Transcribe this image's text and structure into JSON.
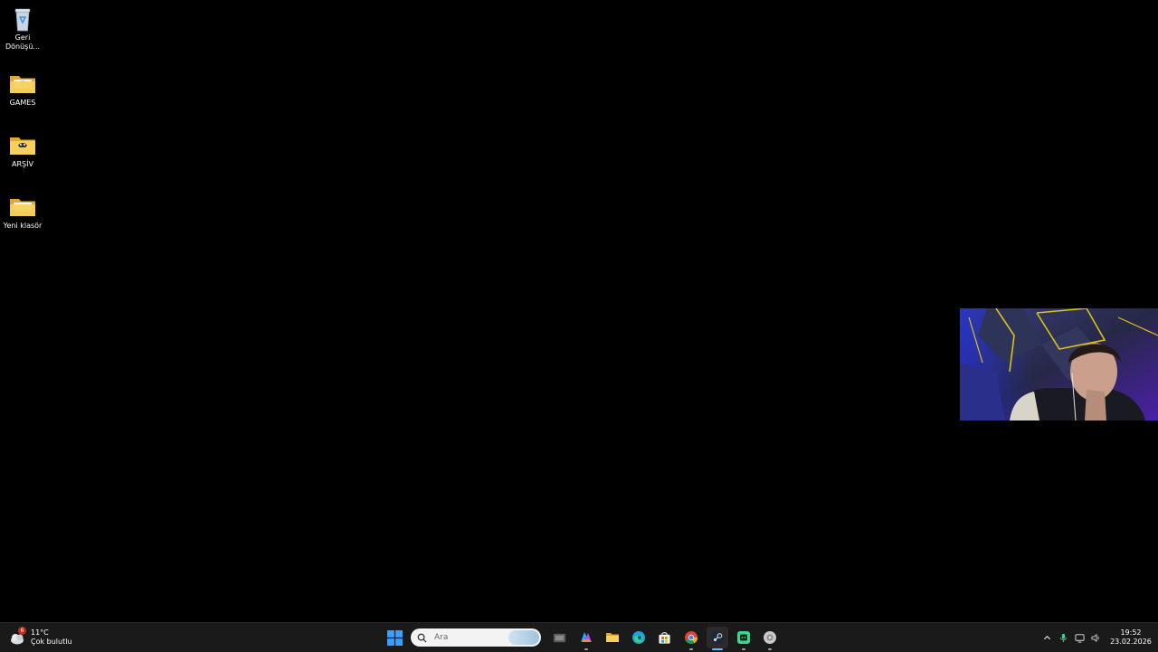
{
  "desktop": {
    "icons": [
      {
        "label": "Geri\nDönüşü...",
        "icon": "recycle-bin-icon"
      },
      {
        "label": "GAMES",
        "icon": "folder-icon"
      },
      {
        "label": "ARŞİV",
        "icon": "folder-icon"
      },
      {
        "label": "Yeni klasör",
        "icon": "folder-icon"
      }
    ]
  },
  "taskbar": {
    "weather": {
      "temperature": "11°C",
      "condition": "Çok bulutlu",
      "badge": "6"
    },
    "search": {
      "placeholder": "Ara"
    },
    "apps": [
      {
        "name": "start",
        "icon": "windows-start-icon"
      },
      {
        "name": "task-view",
        "icon": "task-view-icon"
      },
      {
        "name": "widgets",
        "icon": "widgets-icon"
      },
      {
        "name": "file-explorer",
        "icon": "folder-icon"
      },
      {
        "name": "edge",
        "icon": "edge-icon"
      },
      {
        "name": "store",
        "icon": "store-icon"
      },
      {
        "name": "chrome",
        "icon": "chrome-icon"
      },
      {
        "name": "steam",
        "icon": "steam-icon",
        "active": true
      },
      {
        "name": "app",
        "icon": "green-app-icon"
      },
      {
        "name": "app2",
        "icon": "gray-app-icon"
      }
    ],
    "tray": {
      "icons": [
        "chevron-up-icon",
        "microphone-icon",
        "network-icon",
        "volume-icon"
      ],
      "time": "19:52",
      "date": "23.02.2026"
    }
  },
  "colors": {
    "accent": "#4cc2ff",
    "folder": "#f3c44f",
    "taskbar": "#1a1a1a"
  }
}
